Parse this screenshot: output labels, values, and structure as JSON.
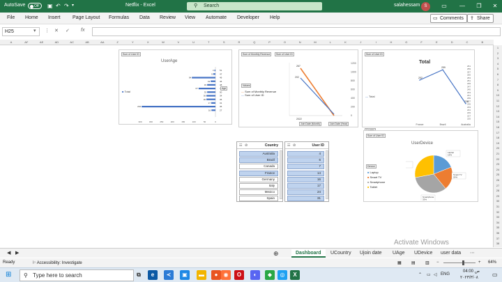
{
  "titlebar": {
    "autosave_label": "AutoSave",
    "autosave_state": "Off",
    "file_title": "Netflix  -  Excel",
    "search_placeholder": "Search",
    "user": "salahessam",
    "avatar_initial": "S"
  },
  "menu": {
    "items": [
      "File",
      "Home",
      "Insert",
      "Page Layout",
      "Formulas",
      "Data",
      "Review",
      "View",
      "Automate",
      "Developer",
      "Help"
    ],
    "comments": "Comments",
    "share": "Share"
  },
  "formula": {
    "cell_ref": "H25",
    "fx": "fx",
    "value": ""
  },
  "columns": [
    "A",
    "AF",
    "AE",
    "AD",
    "AC",
    "AB",
    "AA",
    "Z",
    "Y",
    "X",
    "W",
    "V",
    "U",
    "T",
    "S",
    "R",
    "Q",
    "P",
    "O",
    "N",
    "M",
    "L",
    "K",
    "J",
    "I",
    "H",
    "G",
    "F",
    "E",
    "D",
    "C",
    "B"
  ],
  "rows": [
    "1",
    "2",
    "3",
    "4",
    "5",
    "6",
    "7",
    "8",
    "9",
    "10",
    "11",
    "12",
    "13",
    "14",
    "15",
    "16",
    "17",
    "18",
    "19",
    "20",
    "21",
    "22",
    "23",
    "24",
    "25",
    "26",
    "27",
    "28",
    "29",
    "30",
    "31",
    "32",
    "33",
    "34",
    "35",
    "36",
    "37",
    "38"
  ],
  "charts": {
    "user_age": {
      "field_button": "Sum of User ID",
      "title": "UserAge",
      "legend": "Total",
      "row_labels": [
        "51",
        "47",
        "49",
        "46",
        "48",
        "40",
        "50",
        "34",
        "35",
        "31",
        "36",
        "27"
      ],
      "values": [
        4,
        9,
        94,
        19,
        33,
        67,
        33,
        36,
        36,
        17,
        294,
        16
      ],
      "value_labels": [
        "4",
        "9",
        "94",
        "19",
        "33",
        "67",
        "33",
        "36",
        "36",
        "17",
        "294",
        "16"
      ],
      "x_ticks": [
        "300",
        "300",
        "250",
        "200",
        "150",
        "100",
        "50",
        "0"
      ],
      "filter_button": "Age"
    },
    "revenue": {
      "field_buttons": [
        "Sum of Monthly Revenue",
        "Sum of User ID"
      ],
      "values_button": "Values",
      "legend": [
        "Sum of Monthly Revenue",
        "Sum of User ID"
      ],
      "label_points": [
        "267",
        "202",
        "2022"
      ],
      "y_right_ticks": [
        "1200",
        "1000",
        "800",
        "600",
        "400",
        "200",
        "0"
      ],
      "x_label": "2022",
      "filter_buttons": [
        "Join Date (Month)",
        "Join Date (Year)"
      ],
      "colors": {
        "revenue": "#ed7d31",
        "user": "#4472c4"
      }
    },
    "country_total": {
      "field_button": "Sum of User ID",
      "title": "Total",
      "legend": "Total",
      "chart_data": {
        "type": "line",
        "categories": [
          "France",
          "Brazil",
          "Australia"
        ],
        "values": [
          252,
          259,
          236
        ],
        "title": "Total",
        "ylim": [
          225,
          261
        ]
      },
      "y_ticks": [
        "261",
        "259",
        "257",
        "255",
        "253",
        "251",
        "249",
        "247",
        "245",
        "243",
        "241",
        "239",
        "237",
        "235",
        "233",
        "231",
        "229",
        "227",
        "225"
      ],
      "filter_button": "Country"
    },
    "user_device": {
      "field_button": "Sum of User ID",
      "title": "UserDevice",
      "filter_button": "Device",
      "legend": [
        "Laptop",
        "Smart TV",
        "Smartphone",
        "Tablet"
      ],
      "chart_data": {
        "type": "pie",
        "labels": [
          "Laptop",
          "Smart TV",
          "Smartphone",
          "Tablet"
        ],
        "values": [
          19,
          20,
          33,
          28
        ],
        "title": "UserDevice"
      },
      "data_labels": [
        "Laptop\n19%",
        "Smart TV\n20%",
        "Smartphone\n33%",
        "Tablet\n28%"
      ],
      "colors": [
        "#5b9bd5",
        "#ed7d31",
        "#a5a5a5",
        "#ffc000"
      ]
    }
  },
  "slicers": {
    "country": {
      "title": "Country",
      "items": [
        {
          "label": "Australia",
          "selected": true
        },
        {
          "label": "Brazil",
          "selected": true
        },
        {
          "label": "Canada",
          "selected": false
        },
        {
          "label": "France",
          "selected": true
        },
        {
          "label": "Germany",
          "selected": false
        },
        {
          "label": "Italy",
          "selected": false
        },
        {
          "label": "Mexico",
          "selected": false
        },
        {
          "label": "Spain",
          "selected": false
        }
      ]
    },
    "user_id": {
      "title": "User ID",
      "items": [
        {
          "label": "4",
          "selected": true
        },
        {
          "label": "6",
          "selected": true
        },
        {
          "label": "7",
          "selected": true
        },
        {
          "label": "14",
          "selected": true
        },
        {
          "label": "16",
          "selected": true
        },
        {
          "label": "17",
          "selected": true
        },
        {
          "label": "24",
          "selected": true
        },
        {
          "label": "31",
          "selected": true
        }
      ]
    }
  },
  "sheets": {
    "tabs": [
      "Dashboard",
      "UCountry",
      "Ujoin date",
      "UAge",
      "UDevice",
      "user data"
    ],
    "active": "Dashboard"
  },
  "status": {
    "ready": "Ready",
    "accessibility": "Accessibility: Investigate",
    "zoom": "64%"
  },
  "watermark": {
    "line1": "Activate Windows",
    "line2": "Go to Settings to activate Windows."
  },
  "taskbar": {
    "search_placeholder": "Type here to search",
    "lang": "ENG",
    "time": "04:00 ص",
    "date": "۲۰۲۳/۳/۰۸"
  }
}
